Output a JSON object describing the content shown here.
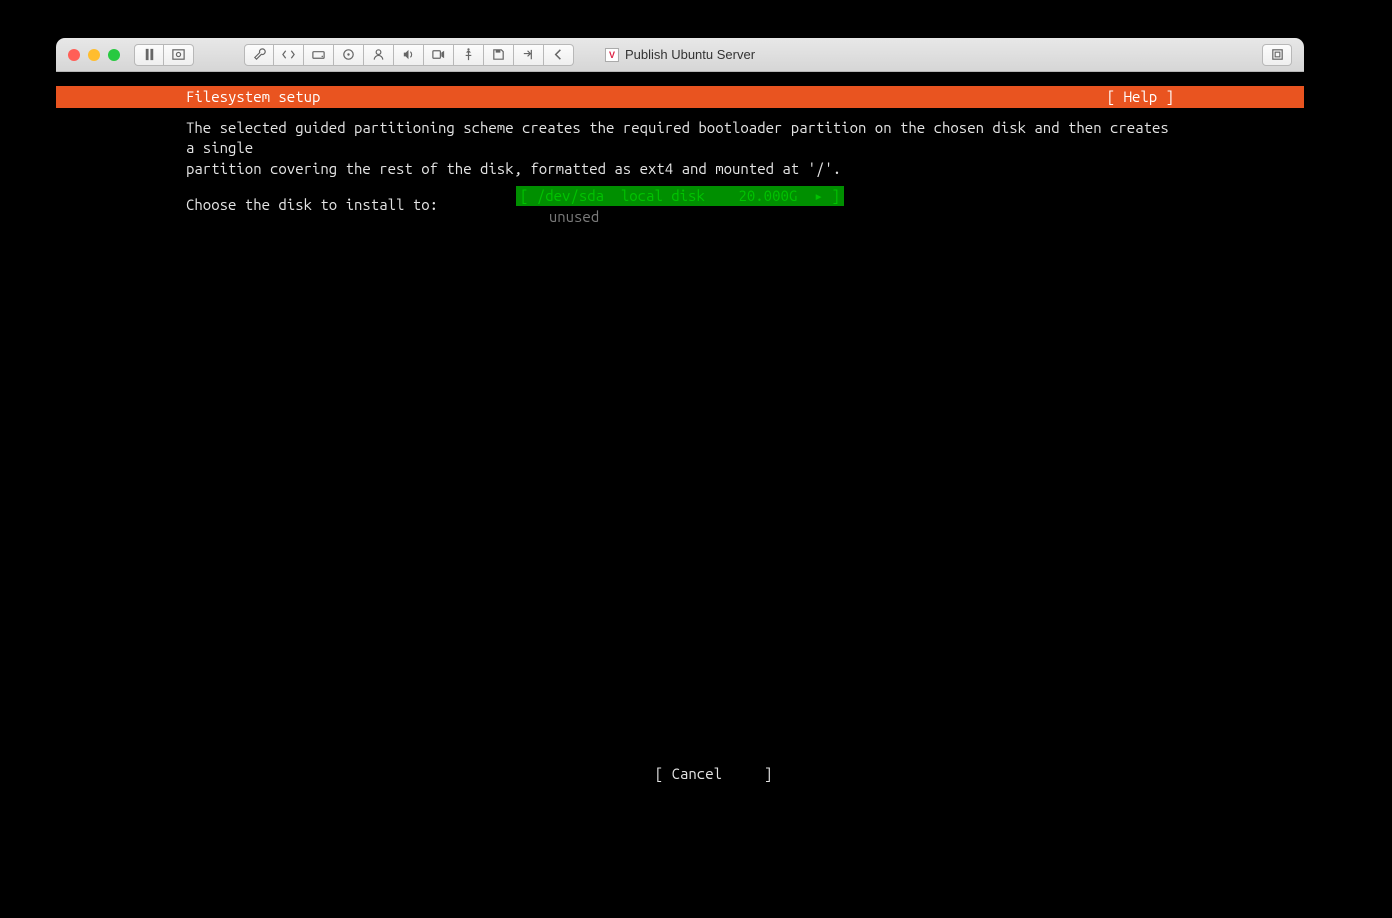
{
  "window": {
    "title": "Publish Ubuntu Server"
  },
  "installer": {
    "header_title": "Filesystem setup",
    "help_label": "[ Help ]",
    "description_line1": "The selected guided partitioning scheme creates the required bootloader partition on the chosen disk and then creates a single",
    "description_line2": "partition covering the rest of the disk, formatted as ext4 and mounted at '/'.",
    "choose_prompt": "Choose the disk to install to:",
    "disk": {
      "device": "/dev/sda",
      "type": "local disk",
      "size": "20.000G",
      "sub": "unused"
    },
    "cancel_label": "[ Cancel     ]"
  }
}
